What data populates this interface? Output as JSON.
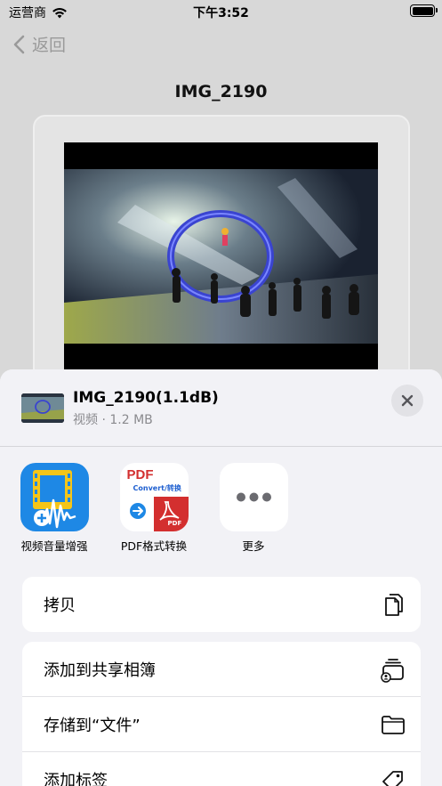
{
  "status_bar": {
    "carrier": "运营商",
    "time": "下午3:52"
  },
  "nav": {
    "back_label": "返回",
    "title": "IMG_2190"
  },
  "share_sheet": {
    "file_name": "IMG_2190(1.1dB)",
    "file_meta": "视频 · 1.2 MB",
    "apps": [
      {
        "label": "视频音量增强",
        "icon": "video-volume-boost-icon",
        "color": "#1e88e5"
      },
      {
        "label": "PDF格式转换",
        "icon": "pdf-convert-icon",
        "color": "#d32f2f"
      },
      {
        "label": "更多",
        "icon": "more-icon"
      }
    ],
    "pdf_icon_text": {
      "title": "PDF",
      "subtitle": "Convert/转换",
      "badge": "PDF"
    },
    "actions_group1": [
      {
        "label": "拷贝",
        "icon": "copy-icon"
      }
    ],
    "actions_group2": [
      {
        "label": "添加到共享相簿",
        "icon": "shared-album-icon"
      },
      {
        "label": "存储到“文件”",
        "icon": "folder-icon"
      },
      {
        "label": "添加标签",
        "icon": "tag-icon"
      }
    ]
  },
  "colors": {
    "accent_blue": "#1e88e5",
    "pdf_red": "#d32f2f",
    "secondary_text": "#8a8a8e"
  }
}
